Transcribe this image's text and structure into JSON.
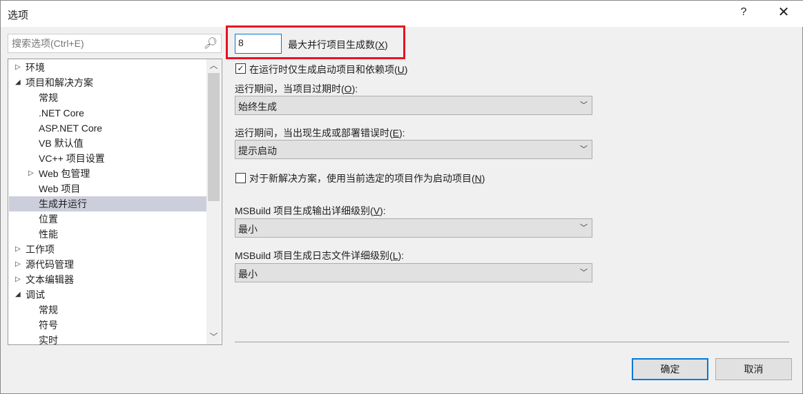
{
  "window": {
    "title": "选项",
    "help": "?",
    "close": "✕"
  },
  "search": {
    "placeholder": "搜索选项(Ctrl+E)",
    "icon": "search-icon"
  },
  "tree": [
    {
      "label": "环境",
      "level": 0,
      "arrow": "collapsed"
    },
    {
      "label": "项目和解决方案",
      "level": 0,
      "arrow": "expanded"
    },
    {
      "label": "常规",
      "level": 1
    },
    {
      "label": ".NET Core",
      "level": 1
    },
    {
      "label": "ASP.NET Core",
      "level": 1
    },
    {
      "label": "VB 默认值",
      "level": 1
    },
    {
      "label": "VC++ 项目设置",
      "level": 1
    },
    {
      "label": "Web 包管理",
      "level": 1,
      "arrow": "collapsed"
    },
    {
      "label": "Web 项目",
      "level": 1
    },
    {
      "label": "生成并运行",
      "level": 1,
      "selected": true
    },
    {
      "label": "位置",
      "level": 1
    },
    {
      "label": "性能",
      "level": 1
    },
    {
      "label": "工作项",
      "level": 0,
      "arrow": "collapsed"
    },
    {
      "label": "源代码管理",
      "level": 0,
      "arrow": "collapsed"
    },
    {
      "label": "文本编辑器",
      "level": 0,
      "arrow": "collapsed"
    },
    {
      "label": "调试",
      "level": 0,
      "arrow": "expanded"
    },
    {
      "label": "常规",
      "level": 1
    },
    {
      "label": "符号",
      "level": 1
    },
    {
      "label": "实时",
      "level": 1
    }
  ],
  "settings": {
    "max_parallel": {
      "value": "8",
      "label": "最大并行项目生成数(",
      "key": "X",
      "end": ")"
    },
    "only_startup": {
      "checked": true,
      "label": "在运行时仅生成启动项目和依赖项(",
      "key": "U",
      "end": ")"
    },
    "outdated": {
      "label": "运行期间，当项目过期时(",
      "key": "O",
      "end": "):",
      "value": "始终生成"
    },
    "errors": {
      "label": "运行期间，当出现生成或部署错误时(",
      "key": "E",
      "end": "):",
      "value": "提示启动"
    },
    "new_solution": {
      "checked": false,
      "label": "对于新解决方案，使用当前选定的项目作为启动项目(",
      "key": "N",
      "end": ")"
    },
    "output_verbosity": {
      "label": "MSBuild 项目生成输出详细级别(",
      "key": "V",
      "end": "):",
      "value": "最小"
    },
    "log_verbosity": {
      "label": "MSBuild 项目生成日志文件详细级别(",
      "key": "L",
      "end": "):",
      "value": "最小"
    }
  },
  "buttons": {
    "ok": "确定",
    "cancel": "取消"
  },
  "colors": {
    "highlight": "#e81123",
    "accent": "#0078d7",
    "selected_row": "#cccedb"
  }
}
